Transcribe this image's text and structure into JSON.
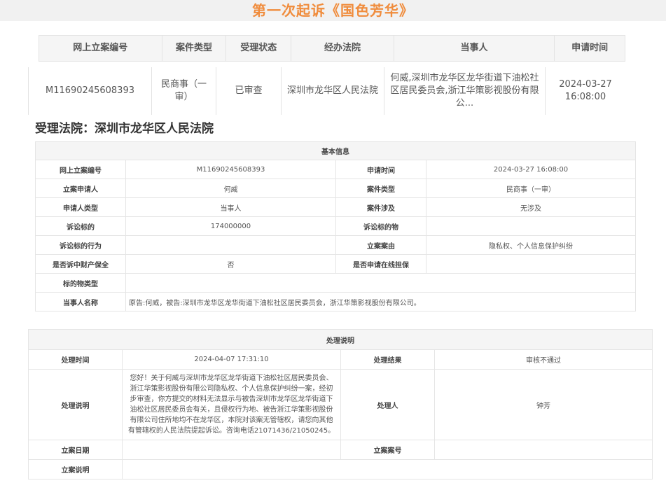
{
  "page": {
    "title": "第一次起诉《国色芳华》"
  },
  "summary": {
    "headers": [
      "网上立案编号",
      "案件类型",
      "受理状态",
      "经办法院",
      "当事人",
      "申请时间"
    ],
    "row": {
      "case_no": "M11690245608393",
      "case_type": "民商事（一审）",
      "status": "已审查",
      "court": "深圳市龙华区人民法院",
      "parties": "何威,深圳市龙华区龙华街道下油松社区居民委员会,浙江华策影视股份有限公...",
      "apply_time": "2024-03-27 16:08:00"
    }
  },
  "court_title": "受理法院：深圳市龙华区人民法院",
  "basic": {
    "header": "基本信息",
    "labels": {
      "case_no": "网上立案编号",
      "apply_time": "申请时间",
      "applicant": "立案申请人",
      "case_type": "案件类型",
      "applicant_type": "申请人类型",
      "involved": "案件涉及",
      "claim_amount": "诉讼标的",
      "claim_object": "诉讼标的物",
      "claim_behavior": "诉讼标的行为",
      "cause": "立案案由",
      "preservation": "是否诉中财产保全",
      "online_guarantee": "是否申请在线担保",
      "object_type": "标的物类型",
      "parties": "当事人名称"
    },
    "values": {
      "case_no": "M11690245608393",
      "apply_time": "2024-03-27 16:08:00",
      "applicant": "何威",
      "case_type": "民商事（一审）",
      "applicant_type": "当事人",
      "involved": "无涉及",
      "claim_amount": "174000000",
      "claim_object": "",
      "claim_behavior": "",
      "cause": "隐私权、个人信息保护纠纷",
      "preservation": "否",
      "online_guarantee": "",
      "object_type": "",
      "parties": "原告:何威，被告:深圳市龙华区龙华街道下油松社区居民委员会，浙江华策影视股份有限公司。"
    }
  },
  "process": {
    "header": "处理说明",
    "labels": {
      "time": "处理时间",
      "result": "处理结果",
      "desc": "处理说明",
      "handler": "处理人",
      "filing_date": "立案日期",
      "filing_no": "立案案号",
      "filing_note": "立案说明"
    },
    "values": {
      "time": "2024-04-07 17:31:10",
      "result": "审核不通过",
      "desc": "您好！关于何威与深圳市龙华区龙华街道下油松社区居民委员会、浙江华策影视股份有限公司隐私权、个人信息保护纠纷一案，经初步审查，你方提交的材料无法显示与被告深圳市龙华区龙华街道下油松社区居民委员会有关，且侵权行为地、被告浙江华策影视股份有限公司住所地均不在龙华区，本院对该案无管辖权，请您向其他有管辖权的人民法院提起诉讼。咨询电话21071436/21050245。",
      "handler": "钟芳",
      "filing_date": "",
      "filing_no": "",
      "filing_note": ""
    }
  }
}
